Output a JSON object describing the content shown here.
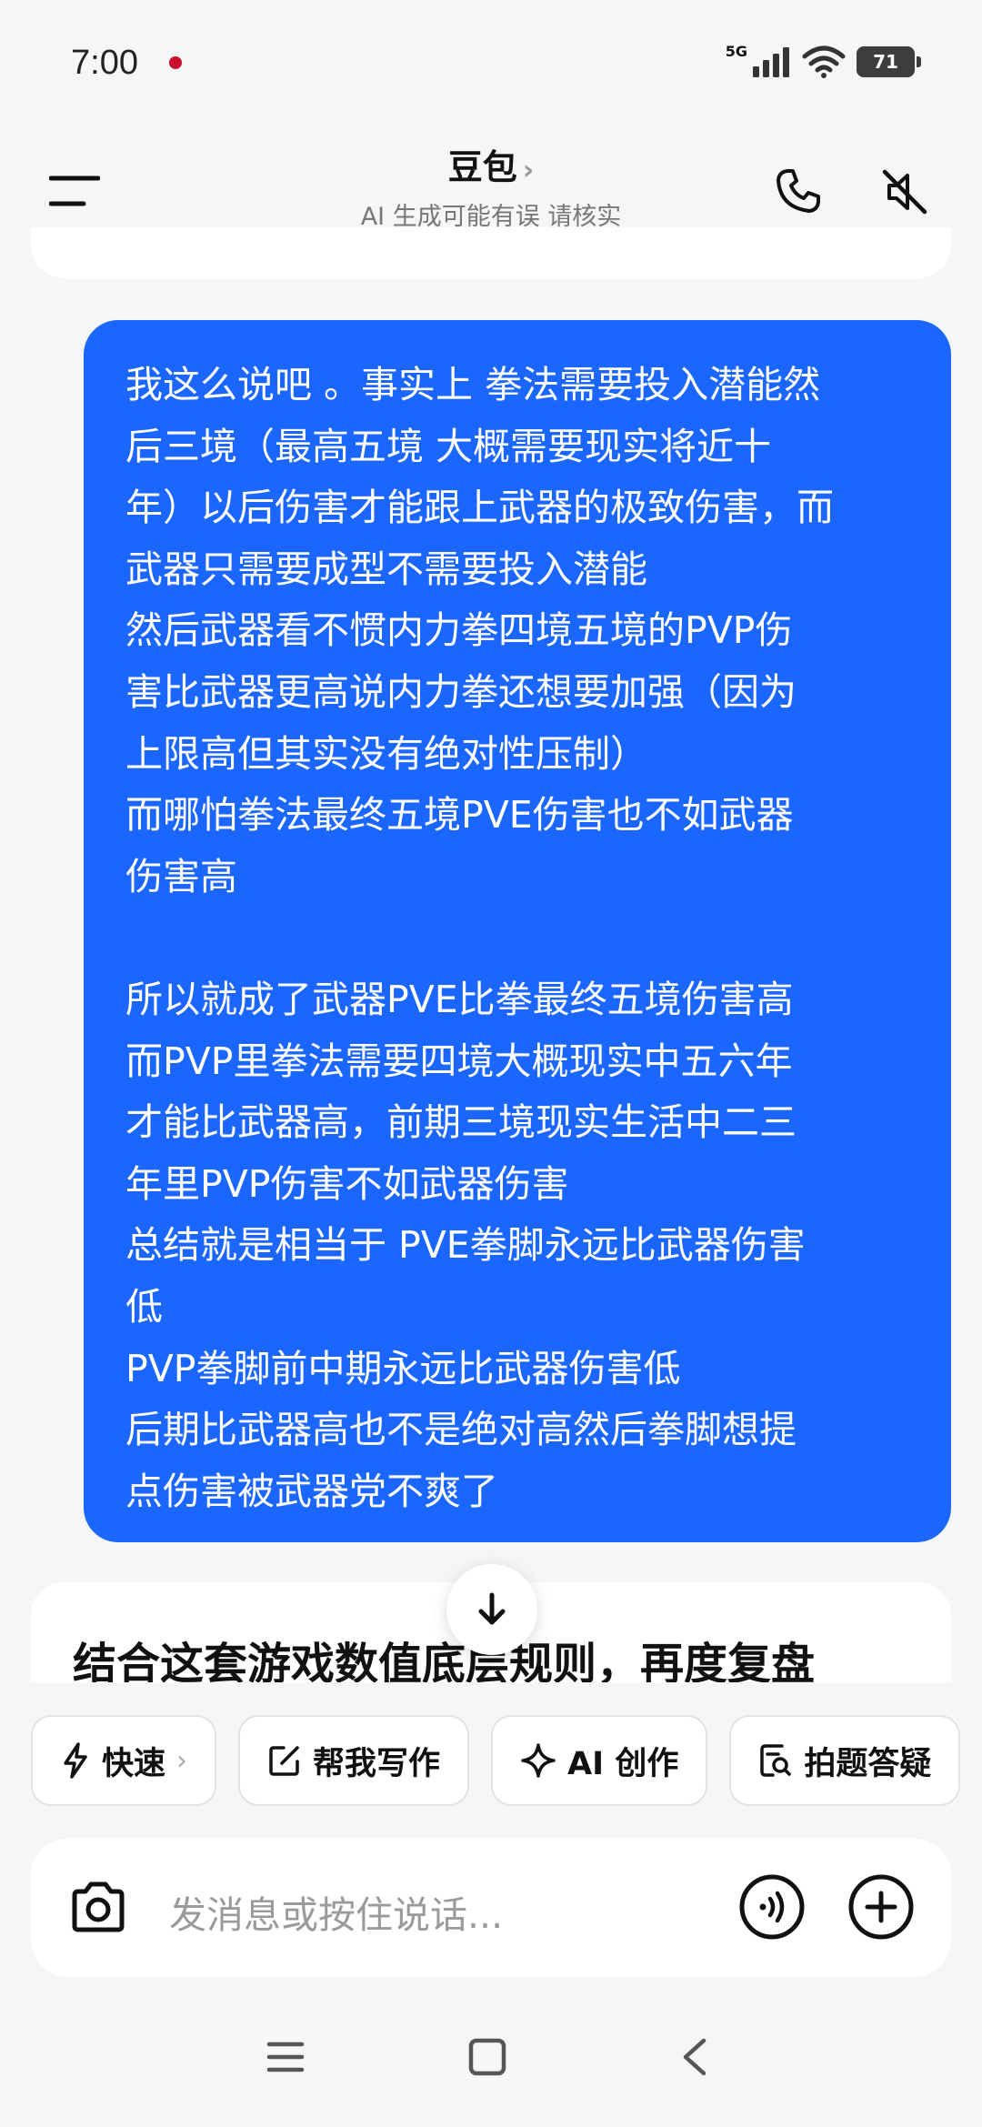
{
  "status_bar": {
    "time": "7:00",
    "network": "5G",
    "battery": "71"
  },
  "header": {
    "title": "豆包",
    "title_chevron": "›",
    "subtitle": "AI 生成可能有误 请核实"
  },
  "user_message": {
    "lines": [
      "我这么说吧 。事实上  拳法需要投入潜能然",
      "后三境（最高五境  大概需要现实将近十",
      "年）以后伤害才能跟上武器的极致伤害，而",
      "武器只需要成型不需要投入潜能",
      "然后武器看不惯内力拳四境五境的PVP伤",
      "害比武器更高说内力拳还想要加强（因为",
      "上限高但其实没有绝对性压制）",
      "而哪怕拳法最终五境PVE伤害也不如武器",
      "伤害高",
      "",
      "所以就成了武器PVE比拳最终五境伤害高",
      "而PVP里拳法需要四境大概现实中五六年",
      "才能比武器高，前期三境现实生活中二三",
      "年里PVP伤害不如武器伤害",
      "总结就是相当于  PVE拳脚永远比武器伤害",
      "低",
      "PVP拳脚前中期永远比武器伤害低",
      "后期比武器高也不是绝对高然后拳脚想提",
      "点伤害被武器党不爽了"
    ]
  },
  "assistant_reply": {
    "title_partial": "结合这套游戏数值底层规则，再度复盘"
  },
  "chips": [
    {
      "label": "快速",
      "chevron": "›",
      "icon": "lightning-icon"
    },
    {
      "label": "帮我写作",
      "icon": "edit-icon"
    },
    {
      "label": "AI 创作",
      "icon": "sparkle-icon"
    },
    {
      "label": "拍题答疑",
      "icon": "scan-question-icon"
    }
  ],
  "input": {
    "placeholder": "发消息或按住说话..."
  },
  "colors": {
    "user_bubble": "#1a66ff",
    "background": "#f5f6f8"
  }
}
